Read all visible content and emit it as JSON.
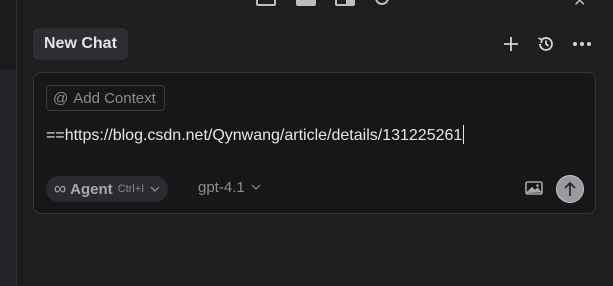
{
  "header": {
    "tab_title": "New Chat",
    "new_chat_icon": "plus-icon",
    "history_icon": "history-icon",
    "more_icon": "more-horizontal-icon"
  },
  "top_bar": {
    "icons": [
      "layout-left-icon",
      "layout-panel-icon",
      "layout-right-icon",
      "settings-icon",
      "close-icon"
    ]
  },
  "composer": {
    "add_context_label": "Add Context",
    "add_context_icon": "at-sign-icon",
    "input_value": "==https://blog.csdn.net/Qynwang/article/details/131225261",
    "mode": {
      "label": "Agent",
      "shortcut": "Ctrl+I",
      "icon": "infinity-icon"
    },
    "model": "gpt-4.1",
    "image_icon": "image-icon",
    "send_icon": "arrow-up-icon"
  },
  "colors": {
    "background": "#1d1e20",
    "composer_bg": "#161719",
    "tab_bg": "#2d2e31",
    "send_button": "#9a9a9e"
  }
}
